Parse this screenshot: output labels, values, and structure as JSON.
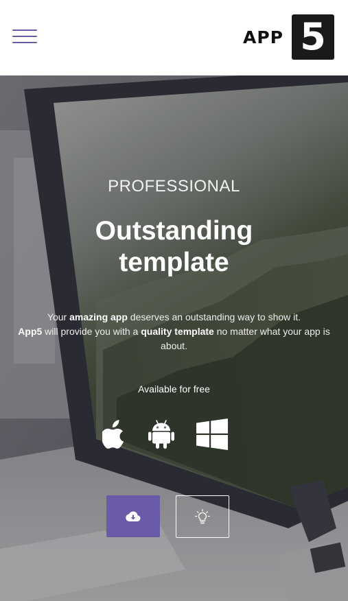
{
  "header": {
    "logo_text": "APP",
    "logo_number": "5"
  },
  "hero": {
    "kicker": "PROFESSIONAL",
    "headline_line1": "Outstanding",
    "headline_line2": "template",
    "description": {
      "part1": "Your ",
      "bold1": "amazing app",
      "part2": " deserves an outstanding way to show it. ",
      "bold2": "App5",
      "part3": " will provide you with a ",
      "bold3": "quality template",
      "part4": " no matter what your app is about."
    },
    "available": "Available for free",
    "platforms": [
      "apple-icon",
      "android-icon",
      "windows-icon"
    ],
    "buttons": {
      "download_icon": "cloud-download-icon",
      "idea_icon": "lightbulb-icon"
    }
  },
  "colors": {
    "accent": "#6a5aa8",
    "header_bg": "#ffffff",
    "logo_box": "#1a1a1a"
  }
}
